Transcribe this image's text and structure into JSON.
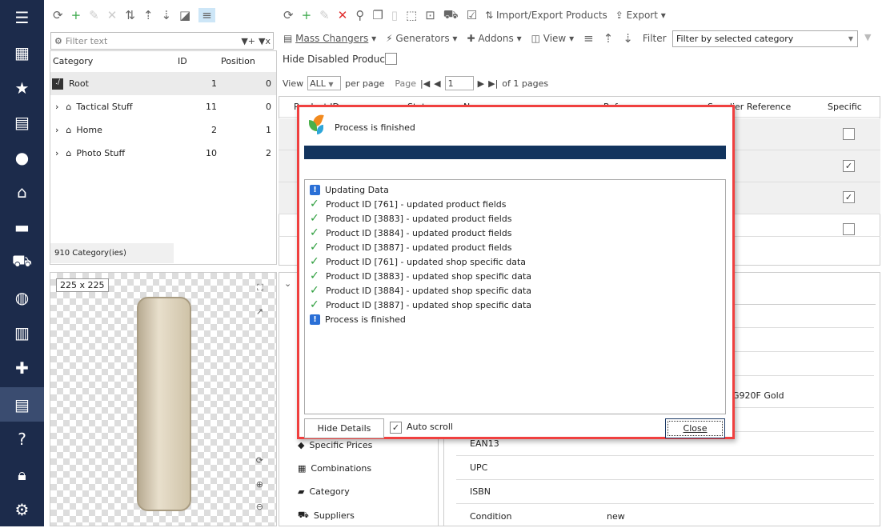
{
  "sidebar": {
    "icons": [
      "menu-icon",
      "store-icon",
      "star-icon",
      "box-icon",
      "user-icon",
      "basket-icon",
      "chat-icon",
      "truck-icon",
      "globe-icon",
      "chart-icon",
      "puzzle-icon",
      "catalog-icon",
      "help-icon",
      "lock-icon",
      "gear-icon"
    ],
    "active_index": 11,
    "bg": "#1c2b4b"
  },
  "left": {
    "filter_placeholder": "Filter text",
    "columns": [
      "Category",
      "ID",
      "Position"
    ],
    "rows": [
      {
        "name": "Root",
        "id": "1",
        "position": "0"
      },
      {
        "name": "Tactical Stuff",
        "id": "11",
        "position": "0"
      },
      {
        "name": "Home",
        "id": "2",
        "position": "1"
      },
      {
        "name": "Photo Stuff",
        "id": "10",
        "position": "2"
      }
    ],
    "count": "910 Category(ies)",
    "image_size": "225 x 225"
  },
  "toolbar": {
    "import_export": "Import/Export Products",
    "export": "Export",
    "mass_changers": "Mass Changers",
    "generators": "Generators",
    "addons": "Addons",
    "view": "View",
    "filter_label": "Filter",
    "filter_value": "Filter by selected category",
    "hide_disabled": "Hide Disabled Products"
  },
  "pager": {
    "view_label": "View",
    "per_page_value": "ALL",
    "per_page": "per page",
    "page_label": "Page",
    "page_value": "1",
    "of_pages": "of 1 pages"
  },
  "grid": {
    "headers": [
      "Product ID",
      "Status",
      "Name",
      "Reference",
      "Supplier Reference",
      "Specific"
    ],
    "specific": [
      false,
      true,
      true,
      false
    ]
  },
  "tabs": [
    "Specific Prices",
    "Combinations",
    "Category",
    "Suppliers"
  ],
  "props": [
    {
      "label": "",
      "value": ""
    },
    {
      "label": "",
      "value": ""
    },
    {
      "label": "",
      "value": ""
    },
    {
      "label": "",
      "value": "G920F Gold"
    },
    {
      "label": "",
      "value": ""
    },
    {
      "label": "EAN13",
      "value": ""
    },
    {
      "label": "UPC",
      "value": ""
    },
    {
      "label": "ISBN",
      "value": ""
    },
    {
      "label": "Condition",
      "value": "new"
    }
  ],
  "dialog": {
    "title": "Process is finished",
    "progress": 100,
    "progress_color": "#12345e",
    "log": [
      {
        "type": "info",
        "text": "Updating Data"
      },
      {
        "type": "ok",
        "text": "Product ID [761] - updated product fields"
      },
      {
        "type": "ok",
        "text": "Product ID [3883] - updated product fields"
      },
      {
        "type": "ok",
        "text": "Product ID [3884] - updated product fields"
      },
      {
        "type": "ok",
        "text": "Product ID [3887] - updated product fields"
      },
      {
        "type": "ok",
        "text": "Product ID [761] - updated shop specific data"
      },
      {
        "type": "ok",
        "text": "Product ID [3883] - updated shop specific data"
      },
      {
        "type": "ok",
        "text": "Product ID [3884] - updated shop specific data"
      },
      {
        "type": "ok",
        "text": "Product ID [3887] - updated shop specific data"
      },
      {
        "type": "info",
        "text": "Process is finished"
      }
    ],
    "hide_details": "Hide Details",
    "auto_scroll": "Auto scroll",
    "auto_scroll_checked": true,
    "close": "Close"
  }
}
